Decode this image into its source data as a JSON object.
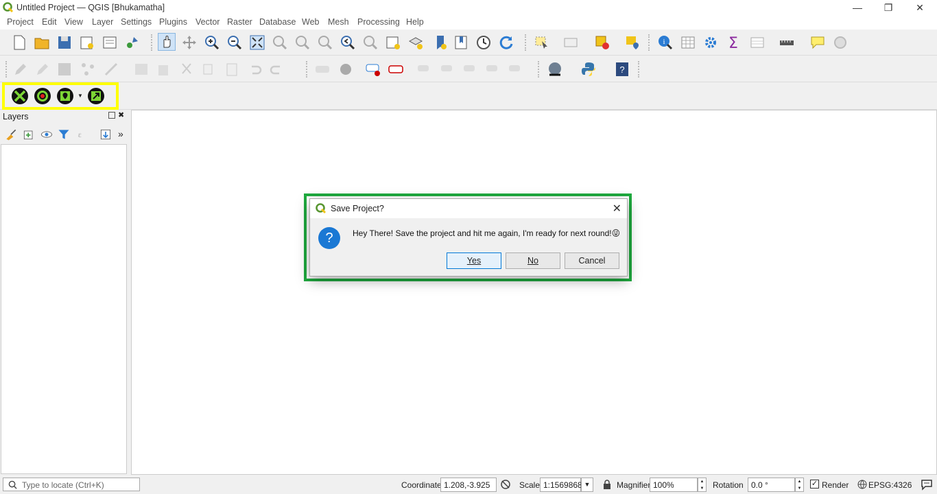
{
  "window": {
    "title": "Untitled Project — QGIS [Bhukamatha]",
    "minimize": "—",
    "restore": "❐",
    "close": "✕"
  },
  "menu": [
    "Project",
    "Edit",
    "View",
    "Layer",
    "Settings",
    "Plugins",
    "Vector",
    "Raster",
    "Database",
    "Web",
    "Mesh",
    "Processing",
    "Help"
  ],
  "layers_panel": {
    "title": "Layers",
    "more": "»"
  },
  "dialog": {
    "title": "Save Project?",
    "message": "Hey There! Save the project and hit me again, I'm ready for next round!😜",
    "icon_glyph": "?",
    "close_glyph": "✕",
    "yes_label": "Yes",
    "no_label": "No",
    "cancel_label": "Cancel"
  },
  "statusbar": {
    "locate_placeholder": "Type to locate (Ctrl+K)",
    "coordinate_label": "Coordinate",
    "coordinate_value": "1.208,-3.925",
    "scale_label": "Scale",
    "scale_value": "1:1569868",
    "magnifier_label": "Magnifier",
    "magnifier_value": "100%",
    "rotation_label": "Rotation",
    "rotation_value": "0.0 °",
    "render_label": "Render",
    "render_checked": true,
    "crs": "EPSG:4326"
  },
  "colors": {
    "highlight_toolbar": "#ffff00",
    "highlight_dialog": "#1fab3f",
    "qgis_green": "#589632",
    "info_blue": "#1a78d4"
  }
}
